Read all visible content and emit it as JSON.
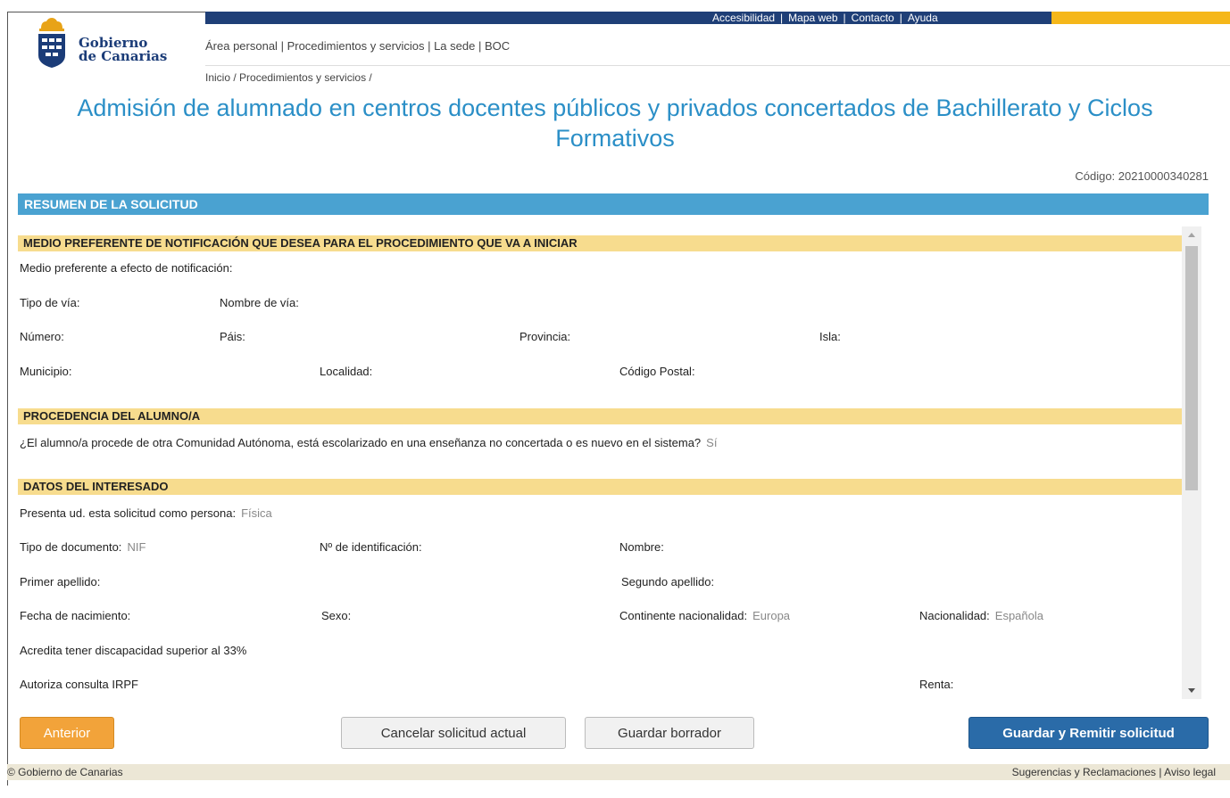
{
  "utility_nav": [
    "Accesibilidad",
    "Mapa web",
    "Contacto",
    "Ayuda"
  ],
  "logo": {
    "line1": "Gobierno",
    "line2": "de Canarias"
  },
  "main_nav": [
    "Área personal",
    "Procedimientos y servicios",
    "La sede",
    "BOC"
  ],
  "breadcrumb": "Inicio / Procedimientos y servicios /",
  "page_title": "Admisión de alumnado en centros docentes públicos y privados concertados de Bachillerato y Ciclos Formativos",
  "code_label": "Código: 20210000340281",
  "summary_title": "RESUMEN DE LA SOLICITUD",
  "sections": {
    "notification": {
      "title": "MEDIO PREFERENTE DE NOTIFICACIÓN QUE DESEA PARA EL PROCEDIMIENTO QUE VA A INICIAR",
      "medio": "Medio preferente a efecto de notificación:",
      "tipo_via": "Tipo de vía:",
      "nombre_via": "Nombre de vía:",
      "numero": "Número:",
      "pais": "Páis:",
      "provincia": "Provincia:",
      "isla": "Isla:",
      "municipio": "Municipio:",
      "localidad": "Localidad:",
      "codigo_postal": "Código Postal:"
    },
    "procedencia": {
      "title": "PROCEDENCIA DEL ALUMNO/A",
      "question": "¿El alumno/a procede de otra Comunidad Autónoma, está escolarizado en una enseñanza no concertada o es nuevo en el sistema?",
      "answer": "Sí"
    },
    "interesado": {
      "title": "DATOS DEL INTERESADO",
      "persona_label": "Presenta ud. esta solicitud como persona:",
      "persona_value": "Física",
      "tipo_doc_label": "Tipo de documento:",
      "tipo_doc_value": "NIF",
      "n_ident": "Nº de identificación:",
      "nombre": "Nombre:",
      "primer_apellido": "Primer apellido:",
      "segundo_apellido": "Segundo apellido:",
      "fecha_nac": "Fecha de nacimiento:",
      "sexo": "Sexo:",
      "continente_label": "Continente nacionalidad:",
      "continente_value": "Europa",
      "nacionalidad_label": "Nacionalidad:",
      "nacionalidad_value": "Española",
      "discapacidad": "Acredita tener discapacidad superior al 33%",
      "irpf": "Autoriza consulta IRPF",
      "renta": "Renta:"
    }
  },
  "buttons": {
    "anterior": "Anterior",
    "cancelar": "Cancelar solicitud actual",
    "guardar_borrador": "Guardar borrador",
    "remitir": "Guardar y Remitir solicitud"
  },
  "footer": {
    "left": "© Gobierno de Canarias",
    "right": "Sugerencias y Reclamaciones | Aviso legal"
  },
  "colors": {
    "accent_blue": "#2b8fc7",
    "header_navy": "#1f3f77",
    "section_yellow": "#f7dc8e",
    "button_orange": "#f2a33a",
    "button_blue": "#2a6ba8"
  }
}
